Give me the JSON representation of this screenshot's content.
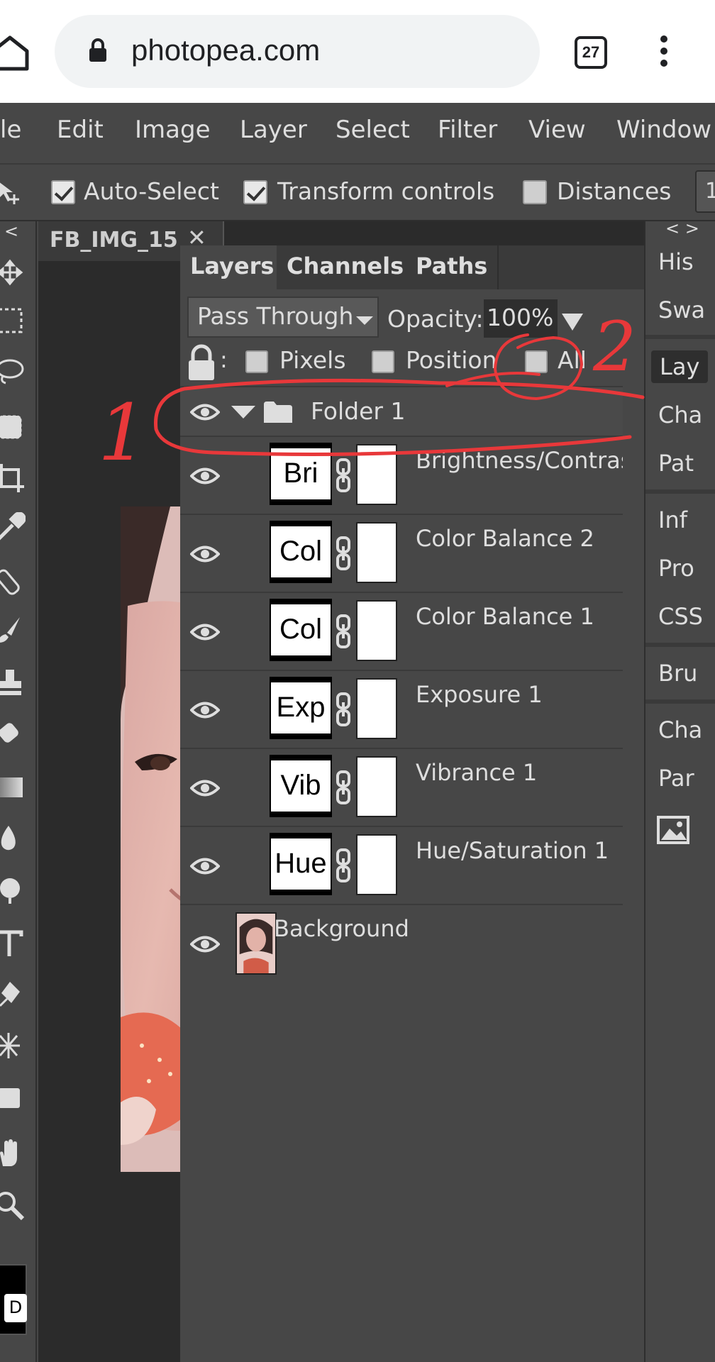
{
  "browser": {
    "url": "photopea.com",
    "tab_count": "27"
  },
  "menu": [
    "le",
    "Edit",
    "Image",
    "Layer",
    "Select",
    "Filter",
    "View",
    "Window"
  ],
  "options": {
    "auto_select": "Auto-Select",
    "transform_controls": "Transform controls",
    "distances": "Distances",
    "overflow": "1"
  },
  "document_tab": {
    "name": "FB_IMG_15",
    "close": "✕"
  },
  "toolbar": {
    "collapse": "<",
    "d_label": "D"
  },
  "layers_panel": {
    "tabs": [
      "Layers",
      "Channels",
      "Paths"
    ],
    "blend_mode": "Pass Through",
    "opacity_label": "Opacity:",
    "opacity_value": "100%",
    "lock_colon": ":",
    "lock_options": [
      "Pixels",
      "Position",
      "All"
    ],
    "folder": {
      "name": "Folder 1"
    },
    "layers": [
      {
        "thumb": "Bri",
        "name": "Brightness/Contrast"
      },
      {
        "thumb": "Col",
        "name": "Color Balance 2"
      },
      {
        "thumb": "Col",
        "name": "Color Balance 1"
      },
      {
        "thumb": "Exp",
        "name": "Exposure 1"
      },
      {
        "thumb": "Vib",
        "name": "Vibrance 1"
      },
      {
        "thumb": "Hue",
        "name": "Hue/Saturation 1"
      }
    ],
    "background": {
      "name": "Background"
    }
  },
  "right_panel": {
    "arrows": "< >",
    "items": [
      "His",
      "Swa",
      "Lay",
      "Cha",
      "Pat",
      "Inf",
      "Pro",
      "CSS",
      "Bru",
      "Cha",
      "Par"
    ],
    "active": "Lay"
  },
  "annotations": {
    "label_1": "1",
    "label_2": "2",
    "color": "#e8383a"
  }
}
